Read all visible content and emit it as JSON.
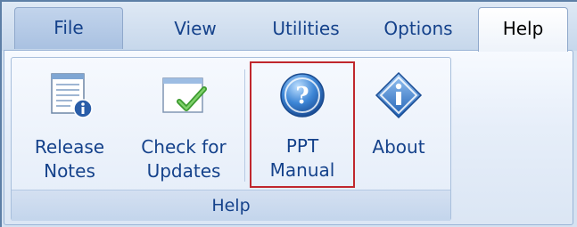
{
  "tabs": {
    "file": "File",
    "view": "View",
    "utilities": "Utilities",
    "options": "Options",
    "help": "Help",
    "active": "Help"
  },
  "group": {
    "label": "Help",
    "buttons": {
      "release_notes": {
        "line1": "Release",
        "line2": "Notes",
        "icon": "release-notes-icon"
      },
      "check_updates": {
        "line1": "Check for",
        "line2": "Updates",
        "icon": "check-updates-icon"
      },
      "ppt_manual": {
        "line1": "PPT",
        "line2": "Manual",
        "icon": "question-icon"
      },
      "about": {
        "line1": "About",
        "icon": "info-icon"
      }
    }
  },
  "colors": {
    "highlight_border": "#c0272d",
    "label_text": "#15428b"
  }
}
